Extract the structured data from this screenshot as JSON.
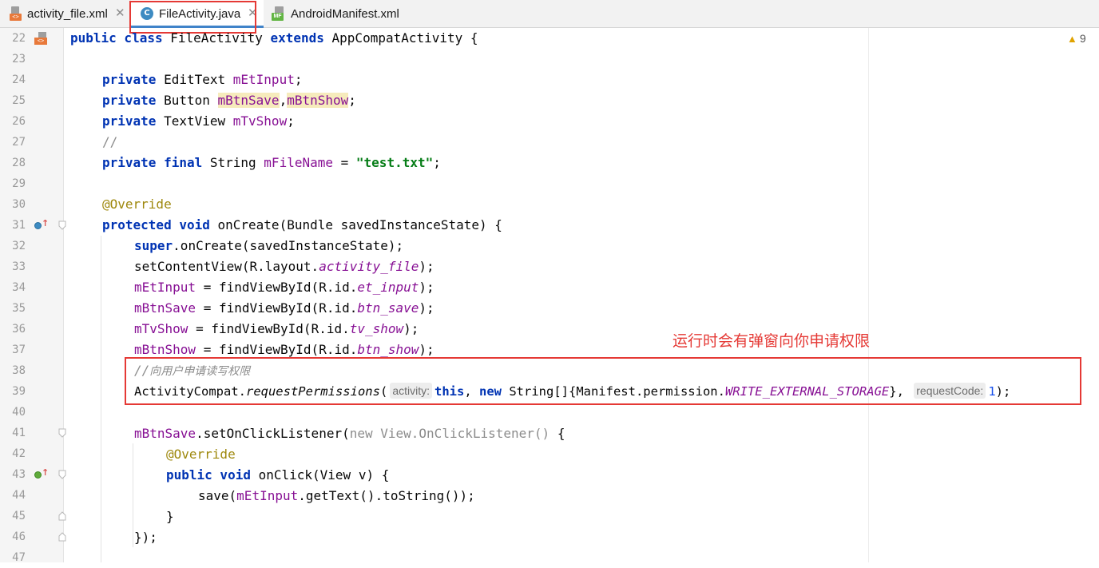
{
  "tabs": [
    {
      "label": "activity_file.xml",
      "icon": "xml-file-icon",
      "close": "✕",
      "active": false
    },
    {
      "label": "FileActivity.java",
      "icon": "java-class-icon",
      "close": "✕",
      "active": true
    },
    {
      "label": "AndroidManifest.xml",
      "icon": "manifest-file-icon",
      "close": "",
      "active": false
    }
  ],
  "icon_text": {
    "xml": "<>",
    "java": "C",
    "manifest": "MF",
    "gutter_class": "<>",
    "override_arrow": "↑",
    "warning_triangle": "▲"
  },
  "colors": {
    "highlight_red": "#e53935",
    "active_tab_underline": "#4083c9",
    "keyword": "#0033b3",
    "string": "#067d17",
    "field": "#871094",
    "annotation": "#9e880d"
  },
  "warnings": {
    "count": "9"
  },
  "annotation_note": "运行时会有弹窗向你申请权限",
  "line_numbers": [
    "22",
    "23",
    "24",
    "25",
    "26",
    "27",
    "28",
    "29",
    "30",
    "31",
    "32",
    "33",
    "34",
    "35",
    "36",
    "37",
    "38",
    "39",
    "40",
    "41",
    "42",
    "43",
    "44",
    "45",
    "46",
    "47"
  ],
  "code": {
    "l22": {
      "kw1": "public class ",
      "t1": "FileActivity ",
      "kw2": "extends ",
      "t2": "AppCompatActivity {"
    },
    "l24": {
      "kw": "private ",
      "t1": "EditText ",
      "f1": "mEtInput",
      "t2": ";"
    },
    "l25": {
      "kw": "private ",
      "t1": "Button ",
      "f1": "mBtnSave",
      "t2": ",",
      "f2": "mBtnShow",
      "t3": ";"
    },
    "l26": {
      "kw": "private ",
      "t1": "TextView ",
      "f1": "mTvShow",
      "t2": ";"
    },
    "l27": {
      "c": "//"
    },
    "l28": {
      "kw": "private final ",
      "t1": "String ",
      "f1": "mFileName",
      "t2": " = ",
      "s": "\"test.txt\"",
      "t3": ";"
    },
    "l30": {
      "a": "@Override"
    },
    "l31": {
      "kw": "protected void ",
      "t1": "onCreate(Bundle savedInstanceState) {"
    },
    "l32": {
      "kw": "super",
      "t1": ".onCreate(savedInstanceState);"
    },
    "l33": {
      "t1": "setContentView(R.layout.",
      "f1": "activity_file",
      "t2": ");"
    },
    "l34": {
      "f0": "mEtInput",
      "t1": " = findViewById(R.id.",
      "f1": "et_input",
      "t2": ");"
    },
    "l35": {
      "f0": "mBtnSave",
      "t1": " = findViewById(R.id.",
      "f1": "btn_save",
      "t2": ");"
    },
    "l36": {
      "f0": "mTvShow",
      "t1": " = findViewById(R.id.",
      "f1": "tv_show",
      "t2": ");"
    },
    "l37": {
      "f0": "mBtnShow",
      "t1": " = findViewById(R.id.",
      "f1": "btn_show",
      "t2": ");"
    },
    "l38": {
      "c1": "//",
      "c2": "向用户申请读写权限"
    },
    "l39": {
      "t1": "ActivityCompat.",
      "m1": "requestPermissions",
      "t2": "(",
      "h1": "activity:",
      "kw1": "this",
      "t3": ", ",
      "kw2": "new ",
      "t4": "String[]{Manifest.permission.",
      "f1": "WRITE_EXTERNAL_STORAGE",
      "t5": "}, ",
      "h2": "requestCode:",
      "n": "1",
      "t6": ");"
    },
    "l41": {
      "f0": "mBtnSave",
      "t1": ".setOnClickListener(",
      "kw": "new ",
      "g": "View.OnClickListener() ",
      "t2": "{"
    },
    "l42": {
      "a": "@Override"
    },
    "l43": {
      "kw": "public void ",
      "t1": "onClick(View v) {"
    },
    "l44": {
      "t1": "save(",
      "f1": "mEtInput",
      "t2": ".getText().toString());"
    },
    "l45": {
      "t1": "}"
    },
    "l46": {
      "t1": "});"
    }
  }
}
